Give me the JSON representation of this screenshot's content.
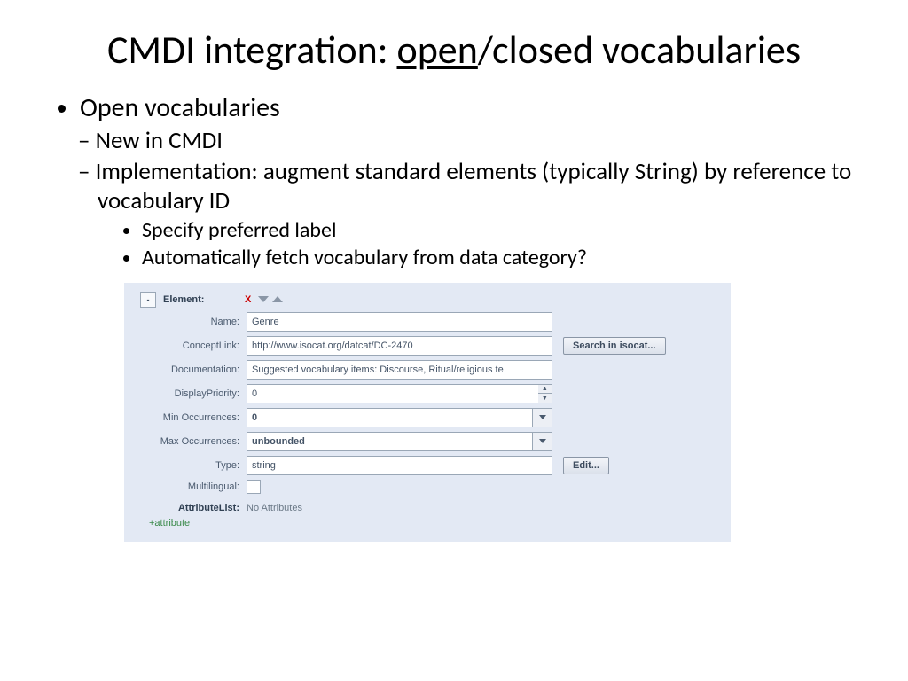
{
  "title": {
    "pre": "CMDI integration: ",
    "underlined": "open",
    "post": "/closed vocabularies"
  },
  "bullets": {
    "l1": "Open vocabularies",
    "l2a": "New in CMDI",
    "l2b": "Implementation: augment standard elements (typically String) by reference to vocabulary ID",
    "l3a": "Specify preferred label",
    "l3b": "Automatically fetch vocabulary from data category?"
  },
  "form": {
    "collapse": "-",
    "heading": "Element:",
    "delete": "X",
    "labels": {
      "name": "Name:",
      "concept": "ConceptLink:",
      "doc": "Documentation:",
      "priority": "DisplayPriority:",
      "min": "Min Occurrences:",
      "max": "Max Occurrences:",
      "type": "Type:",
      "multi": "Multilingual:",
      "attrlist": "AttributeList:"
    },
    "values": {
      "name": "Genre",
      "concept": "http://www.isocat.org/datcat/DC-2470",
      "doc": "Suggested vocabulary items: Discourse, Ritual/religious te",
      "priority": "0",
      "min": "0",
      "max": "unbounded",
      "type": "string"
    },
    "buttons": {
      "search": "Search in isocat...",
      "edit": "Edit..."
    },
    "noattr": "No Attributes",
    "addattr": "+attribute"
  }
}
